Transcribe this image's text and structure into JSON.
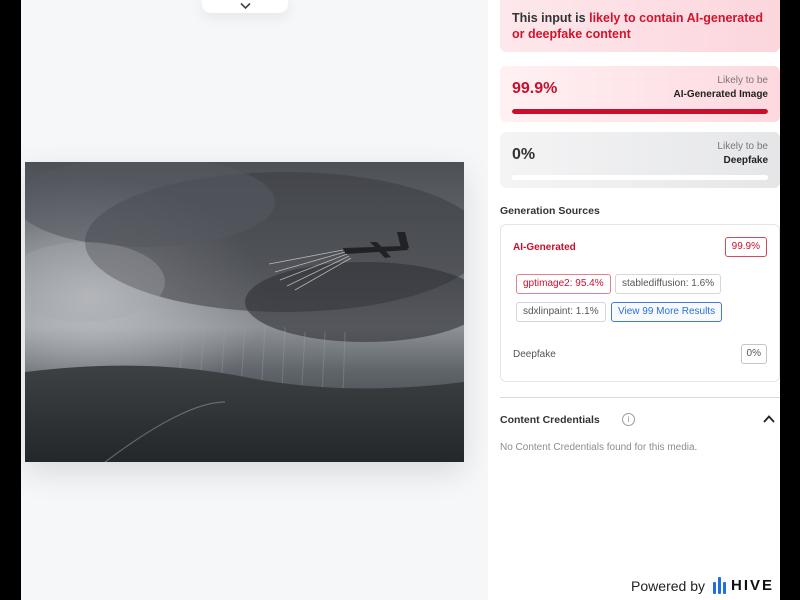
{
  "banner": {
    "prefix": "This input is ",
    "highlight": "likely to contain AI-generated or deepfake content"
  },
  "scores": {
    "ai": {
      "percent": "99.9%",
      "label_top": "Likely to be",
      "label_bottom": "AI-Generated Image",
      "fill_fraction": 0.999
    },
    "deepfake": {
      "percent": "0%",
      "label_top": "Likely to be",
      "label_bottom": "Deepfake",
      "fill_fraction": 0.0
    }
  },
  "generation_sources": {
    "title": "Generation Sources",
    "ai_label": "AI-Generated",
    "ai_percent": "99.9%",
    "chips": [
      "gptimage2: 95.4%",
      "stablediffusion: 1.6%",
      "sdxlinpaint: 1.1%"
    ],
    "more_button": "View 99 More Results",
    "deepfake_label": "Deepfake",
    "deepfake_percent": "0%"
  },
  "content_credentials": {
    "title": "Content Credentials",
    "info_icon": "i",
    "empty_message": "No Content Credentials found for this media."
  },
  "footer": {
    "powered_by": "Powered by",
    "brand": "HIVE"
  },
  "colors": {
    "accent_red": "#c8102e",
    "link_blue": "#2d6fd8",
    "brand_blue": "#1f6fe0"
  },
  "icons": [
    "chevron-down-icon",
    "info-icon",
    "chevron-up-icon",
    "hive-logo-icon"
  ]
}
